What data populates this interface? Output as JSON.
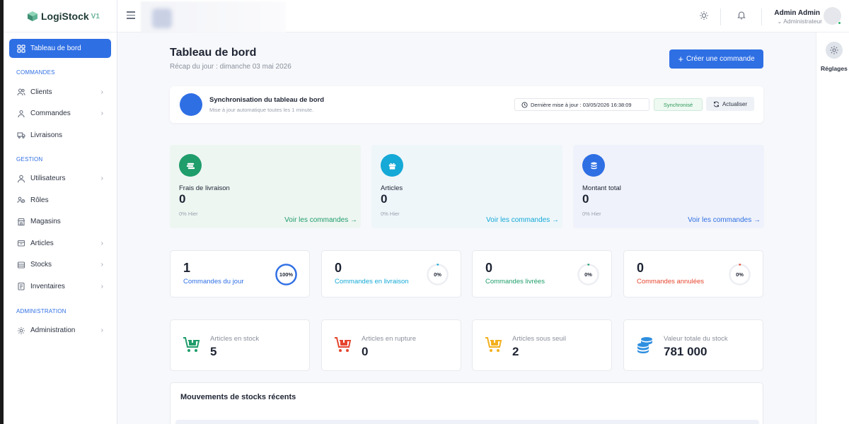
{
  "app": {
    "name": "LogiStock",
    "version": "V1"
  },
  "sidebar": {
    "active": {
      "label": "Tableau de bord"
    },
    "sections": [
      {
        "title": "COMMANDES",
        "items": [
          {
            "label": "Clients",
            "icon": "users-icon",
            "has_children": true
          },
          {
            "label": "Commandes",
            "icon": "orders-icon",
            "has_children": true
          },
          {
            "label": "Livraisons",
            "icon": "truck-icon",
            "has_children": false
          }
        ]
      },
      {
        "title": "GESTION",
        "items": [
          {
            "label": "Utilisateurs",
            "icon": "user-icon",
            "has_children": true
          },
          {
            "label": "Rôles",
            "icon": "roles-icon",
            "has_children": false
          },
          {
            "label": "Magasins",
            "icon": "store-icon",
            "has_children": false
          },
          {
            "label": "Articles",
            "icon": "box-icon",
            "has_children": true
          },
          {
            "label": "Stocks",
            "icon": "stock-icon",
            "has_children": true
          },
          {
            "label": "Inventaires",
            "icon": "inventory-icon",
            "has_children": true
          }
        ]
      },
      {
        "title": "ADMINISTRATION",
        "items": [
          {
            "label": "Administration",
            "icon": "gear-icon",
            "has_children": true
          }
        ]
      }
    ]
  },
  "topbar": {
    "user_name": "Admin Admin",
    "user_role": "Administrateur"
  },
  "right_panel": {
    "settings_label": "Réglages"
  },
  "page": {
    "title": "Tableau de bord",
    "subtitle": "Récap du jour : dimanche 03 mai 2026",
    "create_button": "Créer une commande"
  },
  "sync": {
    "title": "Synchronisation du tableau de bord",
    "subtitle": "Mise à jour automatique toutes les 1 minute.",
    "last_update": "Dernière mise à jour : 03/05/2026 16:38:09",
    "status": "Synchronisé",
    "refresh_label": "Actualiser"
  },
  "finance": [
    {
      "label": "Frais de livraison",
      "value": "0",
      "hier": "0% Hier",
      "link": "Voir les commandes →",
      "color": "#1f9d6b",
      "icon": "money-stack-icon"
    },
    {
      "label": "Articles",
      "value": "0",
      "hier": "0% Hier",
      "link": "Voir les commandes →",
      "color": "#14a9d6",
      "icon": "gift-icon"
    },
    {
      "label": "Montant total",
      "value": "0",
      "hier": "0% Hier",
      "link": "Voir les commandes →",
      "color": "#2f6fe4",
      "icon": "coins-icon"
    }
  ],
  "orders": [
    {
      "value": "1",
      "label": "Commandes du jour",
      "pct_label": "100%",
      "pct": 100,
      "color": "#2f6fe4"
    },
    {
      "value": "0",
      "label": "Commandes en livraison",
      "pct_label": "0%",
      "pct": 0,
      "color": "#14a9d6"
    },
    {
      "value": "0",
      "label": "Commandes livrées",
      "pct_label": "0%",
      "pct": 0,
      "color": "#1f9d6b"
    },
    {
      "value": "0",
      "label": "Commandes annulées",
      "pct_label": "0%",
      "pct": 0,
      "color": "#e5452f"
    }
  ],
  "stocks": [
    {
      "label": "Articles en stock",
      "value": "5",
      "color": "#1f9d6b",
      "icon": "cart-icon"
    },
    {
      "label": "Articles en rupture",
      "value": "0",
      "color": "#e5452f",
      "icon": "cart-icon"
    },
    {
      "label": "Articles sous seuil",
      "value": "2",
      "color": "#f2b01e",
      "icon": "cart-icon"
    },
    {
      "label": "Valeur totale du stock",
      "value": "781 000",
      "color": "#2f8fe0",
      "icon": "coins-icon"
    }
  ],
  "movements": {
    "title": "Mouvements de stocks récents"
  }
}
